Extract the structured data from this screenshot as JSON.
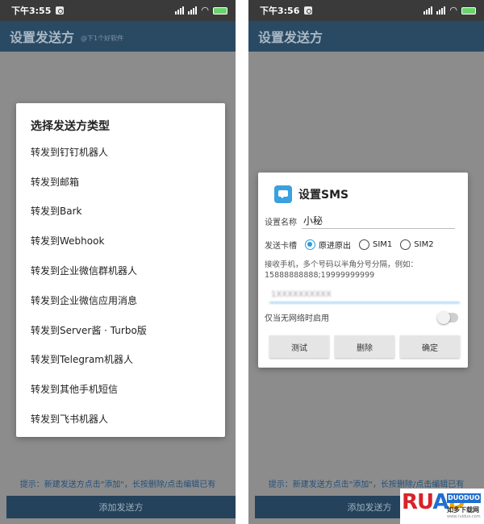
{
  "left": {
    "status": {
      "time": "下午3:55"
    },
    "appbar": {
      "title": "设置发送方",
      "watermark": "@下1个好软件"
    },
    "type_dialog": {
      "title": "选择发送方类型",
      "items": [
        "转发到钉钉机器人",
        "转发到邮箱",
        "转发到Bark",
        "转发到Webhook",
        "转发到企业微信群机器人",
        "转发到企业微信应用消息",
        "转发到Server酱 · Turbo版",
        "转发到Telegram机器人",
        "转发到其他手机短信",
        "转发到飞书机器人"
      ]
    },
    "hint": "提示：新建发送方点击\"添加\"，长按删除/点击编辑已有",
    "add_button": "添加发送方"
  },
  "right": {
    "status": {
      "time": "下午3:56"
    },
    "appbar": {
      "title": "设置发送方"
    },
    "sms_dialog": {
      "title": "设置SMS",
      "name_label": "设置名称",
      "name_value": "小秘",
      "sim_label": "发送卡槽",
      "sim_options": [
        "原进原出",
        "SIM1",
        "SIM2"
      ],
      "sim_selected": "原进原出",
      "receive_hint": "接收手机，多个号码以半角分号分隔，例如：15888888888;19999999999",
      "phone_value": "1XXXXXXXXXX",
      "toggle_label": "仅当无网络时启用",
      "toggle_on": false,
      "buttons": {
        "test": "测试",
        "delete": "删除",
        "confirm": "确定"
      }
    },
    "hint": "提示：新建发送方点击\"添加\"，长按删除/点击编辑已有",
    "add_button": "添加发送方"
  },
  "logo": {
    "brand": "RUANDAO",
    "tag": "DUODUO",
    "zh": "如多下载网",
    "url": "www.rulduo.com"
  },
  "colors": {
    "appbar": "#2a4a64",
    "accent": "#2b9cdc",
    "scrim": "#8c8c8c"
  }
}
